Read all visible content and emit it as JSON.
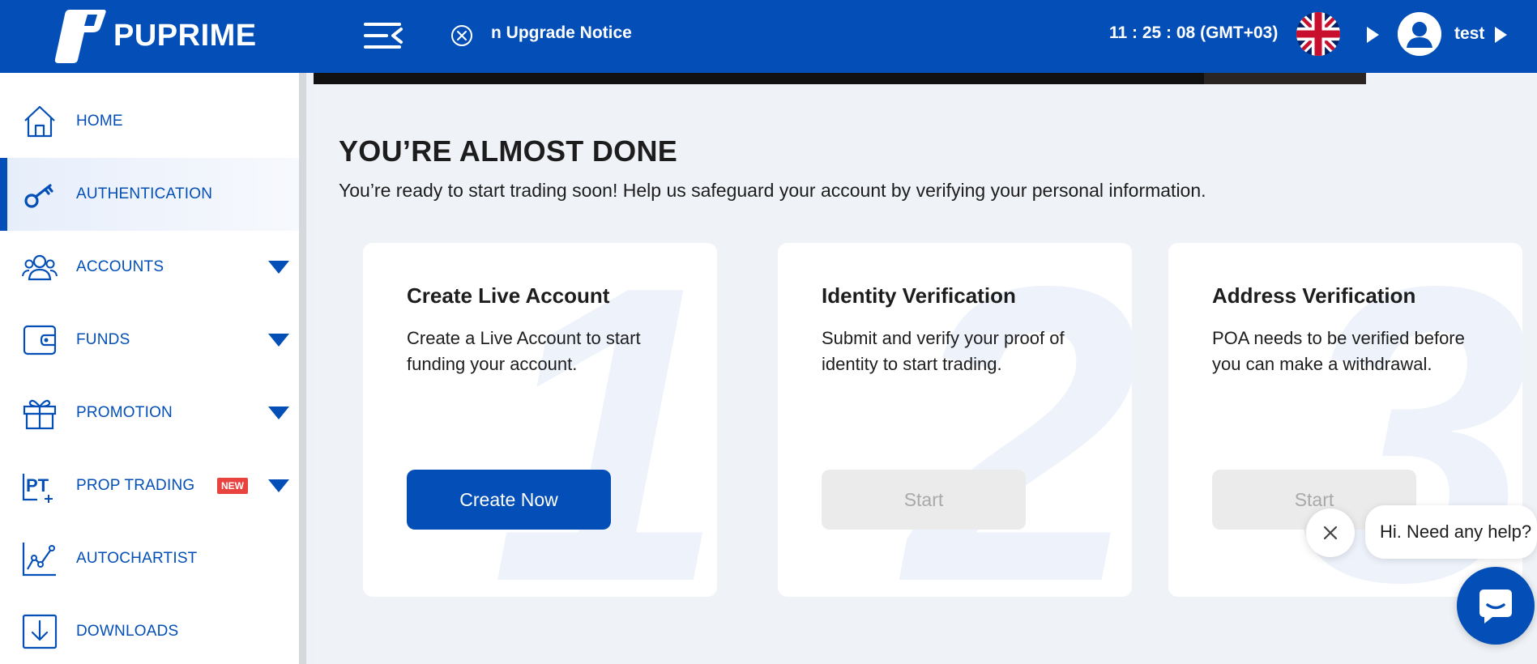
{
  "header": {
    "brand": "PUPRIME",
    "notice": "n Upgrade Notice",
    "clock": "11 : 25 : 08 (GMT+03)",
    "username": "test",
    "accent_color": "#034fb7"
  },
  "sidebar": {
    "items": [
      {
        "label": "HOME",
        "icon": "home-icon",
        "active": false,
        "expandable": false
      },
      {
        "label": "AUTHENTICATION",
        "icon": "key-icon",
        "active": true,
        "expandable": false
      },
      {
        "label": "ACCOUNTS",
        "icon": "users-icon",
        "active": false,
        "expandable": true
      },
      {
        "label": "FUNDS",
        "icon": "wallet-icon",
        "active": false,
        "expandable": true
      },
      {
        "label": "PROMOTION",
        "icon": "gift-icon",
        "active": false,
        "expandable": true
      },
      {
        "label": "PROP TRADING",
        "icon": "pt-icon",
        "active": false,
        "expandable": true,
        "badge": "NEW"
      },
      {
        "label": "AUTOCHARTIST",
        "icon": "chart-icon",
        "active": false,
        "expandable": false
      },
      {
        "label": "DOWNLOADS",
        "icon": "download-icon",
        "active": false,
        "expandable": false
      }
    ]
  },
  "main": {
    "title": "YOU’RE ALMOST DONE",
    "subtitle": "You’re ready to start trading soon! Help us safeguard your account by verifying your personal information.",
    "cards": [
      {
        "number": "1",
        "title": "Create Live Account",
        "description": "Create a Live Account to start funding your account.",
        "button": "Create Now",
        "enabled": true
      },
      {
        "number": "2",
        "title": "Identity Verification",
        "description": "Submit and verify your proof of identity to start trading.",
        "button": "Start",
        "enabled": false
      },
      {
        "number": "3",
        "title": "Address Verification",
        "description": "POA needs to be verified before you can make a withdrawal.",
        "button": "Start",
        "enabled": false
      }
    ]
  },
  "chat": {
    "greeting": "Hi. Need any help?"
  }
}
